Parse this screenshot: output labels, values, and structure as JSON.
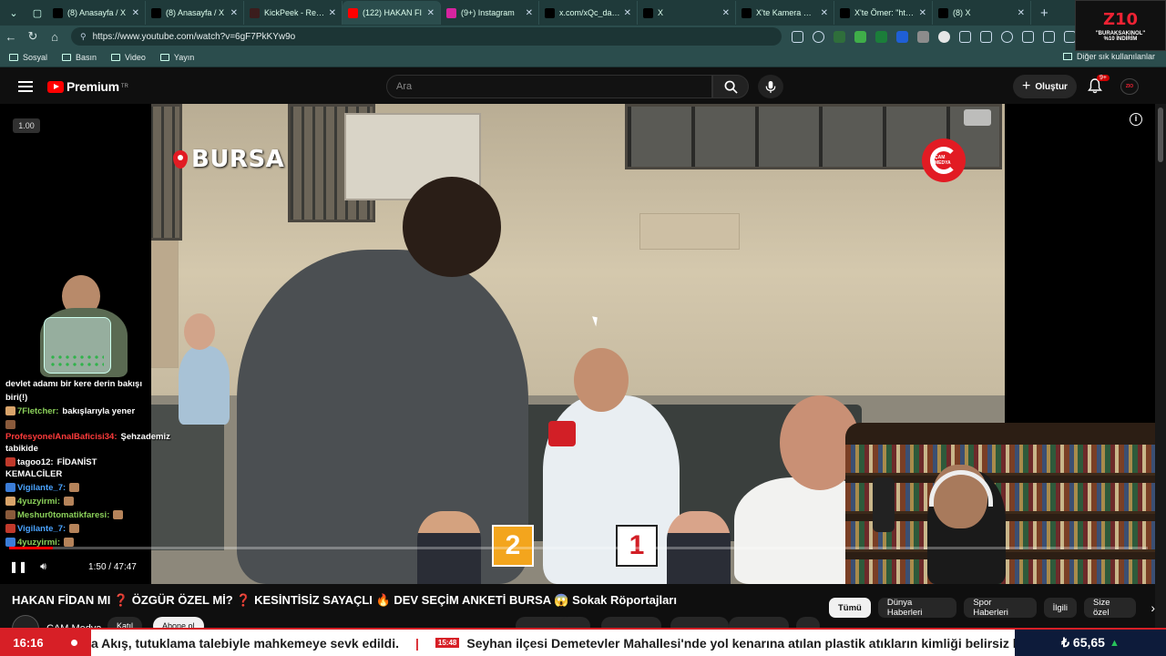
{
  "browser": {
    "tabs": [
      {
        "label": "(8) Anasayfa / X",
        "icon": "x-logo-icon",
        "fav_color": "#000000",
        "active": false
      },
      {
        "label": "(8) Anasayfa / X",
        "icon": "x-logo-icon",
        "fav_color": "#000000",
        "active": false
      },
      {
        "label": "KickPeek - Real-tim",
        "icon": "kickpeek-icon",
        "fav_color": "#3b1d1d",
        "active": false
      },
      {
        "label": "(122) HAKAN FI",
        "icon": "youtube-icon",
        "fav_color": "#ff0000",
        "active": true
      },
      {
        "label": "(9+) Instagram",
        "icon": "instagram-icon",
        "fav_color": "#d6249f",
        "active": false
      },
      {
        "label": "x.com/xQc_dailyy/st",
        "icon": "x-logo-icon",
        "fav_color": "#000000",
        "active": false
      },
      {
        "label": "X",
        "icon": "x-logo-icon",
        "fav_color": "#000000",
        "active": false
      },
      {
        "label": "X'te Kamera Kaydı C",
        "icon": "x-logo-icon",
        "fav_color": "#000000",
        "active": false
      },
      {
        "label": "X'te Ömer: \"https://",
        "icon": "x-logo-icon",
        "fav_color": "#000000",
        "active": false
      },
      {
        "label": "(8) X",
        "icon": "x-logo-icon",
        "fav_color": "#000000",
        "active": false
      }
    ],
    "url": "https://www.youtube.com/watch?v=6gF7PkKYw9o",
    "bookmarks": [
      "Sosyal",
      "Basın",
      "Video",
      "Yayın"
    ],
    "bookmarks_right": "Diğer sık kullanılanlar"
  },
  "promo": {
    "logo": "Z10",
    "line1": "\"BURAKSAKINOL\"",
    "line2": "%10 İNDİRİM"
  },
  "youtube": {
    "logo_text": "Premium",
    "logo_region": "TR",
    "search_placeholder": "Ara",
    "create_label": "Oluştur",
    "notif_count": "9+",
    "avatar_text": "ZIO"
  },
  "video": {
    "location_tag": "BURSA",
    "speed_label": "1.00",
    "vote_left": "2",
    "vote_right": "1",
    "cam_logo_text": "ÇAM MEDYA",
    "time": "1:50 / 47:47",
    "progress_fraction": 0.038,
    "title": "HAKAN FİDAN MI ❓ ÖZGÜR ÖZEL Mİ? ❓ KESİNTİSİZ SAYAÇLI 🔥 DEV SEÇİM ANKETİ BURSA 😱 Sokak Röportajları",
    "channel": "CAM Medya"
  },
  "chat": [
    {
      "user": "",
      "msg": "devlet adamı bir kere derin bakışı",
      "user_color": "#ffffff"
    },
    {
      "user": "",
      "msg": "biri(!)",
      "user_color": "#ffffff"
    },
    {
      "user": "7Fletcher:",
      "msg": "bakışlarıyla yener",
      "user_color": "#8bd05a"
    },
    {
      "user": "ProfesyonelAnalBaficisi34:",
      "msg": "Şehzademiz tabikide",
      "user_color": "#ff3b3b"
    },
    {
      "user": "tagoo12:",
      "msg": "FİDANİST KEMALCİLER",
      "user_color": "#ffffff"
    },
    {
      "user": "Vigilante_7:",
      "msg": "",
      "user_color": "#4aa3ff"
    },
    {
      "user": "4yuzyirmi:",
      "msg": "",
      "user_color": "#8bd05a"
    },
    {
      "user": "Meshur0tomatikfaresi:",
      "msg": "",
      "user_color": "#8bd05a"
    },
    {
      "user": "Vigilante_7:",
      "msg": "",
      "user_color": "#4aa3ff"
    },
    {
      "user": "4yuzyirmi:",
      "msg": "",
      "user_color": "#8bd05a"
    }
  ],
  "chips": [
    "Tümü",
    "Dünya Haberleri",
    "Spor Haberleri",
    "İlgili",
    "Size özel"
  ],
  "below_pills": [
    "Katıl",
    "Abone ol"
  ],
  "ticker": {
    "clock": "16:16",
    "news1": "a Akış, tutuklama talebiyle mahkemeye sevk edildi.",
    "stamp": "15:48",
    "news2": "Seyhan ilçesi Demetevler Mahallesi'nde yol kenarına atılan plastik atıkların kimliği belirsiz kişile",
    "price": "₺ 65,65"
  }
}
